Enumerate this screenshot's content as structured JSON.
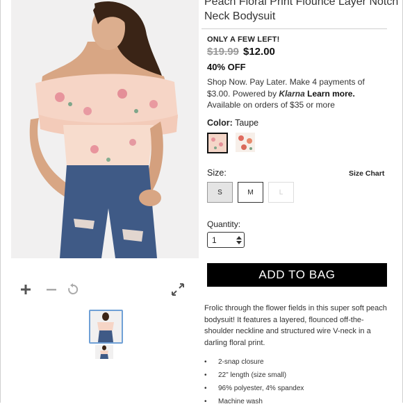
{
  "product": {
    "title": "Peach Floral Print Flounce Layer Notch Neck Bodysuit",
    "stock_notice": "ONLY A FEW LEFT!",
    "was_price": "$19.99",
    "price": "$12.00",
    "discount": "40% OFF",
    "klarna_text": "Shop Now. Pay Later. Make 4 payments of $3.00. Powered by",
    "klarna_brand": "Klarna",
    "klarna_link": "Learn more.",
    "klarna_tail": "Available on orders of $35 or more",
    "color_label": "Color:",
    "color_value": "Taupe",
    "size_label": "Size:",
    "size_chart": "Size Chart",
    "sizes": [
      "S",
      "M",
      "L"
    ],
    "quantity_label": "Quantity:",
    "quantity_value": "1",
    "add_to_bag": "ADD TO BAG",
    "description": "Frolic through the flower fields in this super soft peach bodysuit! It features a layered, flounced off-the-shoulder neckline and structured wire V-neck in a darling floral print.",
    "details": [
      "2-snap closure",
      "22\" length (size small)",
      "96% polyester, 4% spandex",
      "Machine wash"
    ]
  },
  "colors": {
    "accent": "#000000",
    "thumb_border": "#6fa0d6",
    "peach": "#f6d8c8"
  },
  "icons": [
    "zoom-in-icon",
    "zoom-out-icon",
    "reset-icon",
    "fullscreen-icon",
    "quantity-arrows-icon"
  ]
}
